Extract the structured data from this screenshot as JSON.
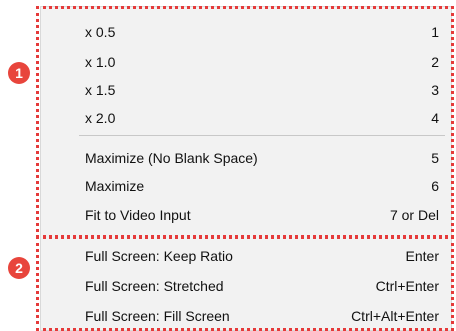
{
  "menu": {
    "zoom_items": [
      {
        "label": "x 0.5",
        "shortcut": "1"
      },
      {
        "label": "x 1.0",
        "shortcut": "2"
      },
      {
        "label": "x 1.5",
        "shortcut": "3"
      },
      {
        "label": "x 2.0",
        "shortcut": "4"
      }
    ],
    "size_items": [
      {
        "label": "Maximize (No Blank Space)",
        "shortcut": "5"
      },
      {
        "label": "Maximize",
        "shortcut": "6"
      },
      {
        "label": "Fit to Video Input",
        "shortcut": "7 or Del"
      }
    ],
    "fullscreen_items": [
      {
        "label": "Full Screen: Keep Ratio",
        "shortcut": "Enter"
      },
      {
        "label": "Full Screen: Stretched",
        "shortcut": "Ctrl+Enter"
      },
      {
        "label": "Full Screen: Fill Screen",
        "shortcut": "Ctrl+Alt+Enter"
      }
    ]
  },
  "annotations": {
    "badge_1": "1",
    "badge_2": "2",
    "highlight_color": "#e53a3a",
    "badge_color": "#e8453c"
  }
}
